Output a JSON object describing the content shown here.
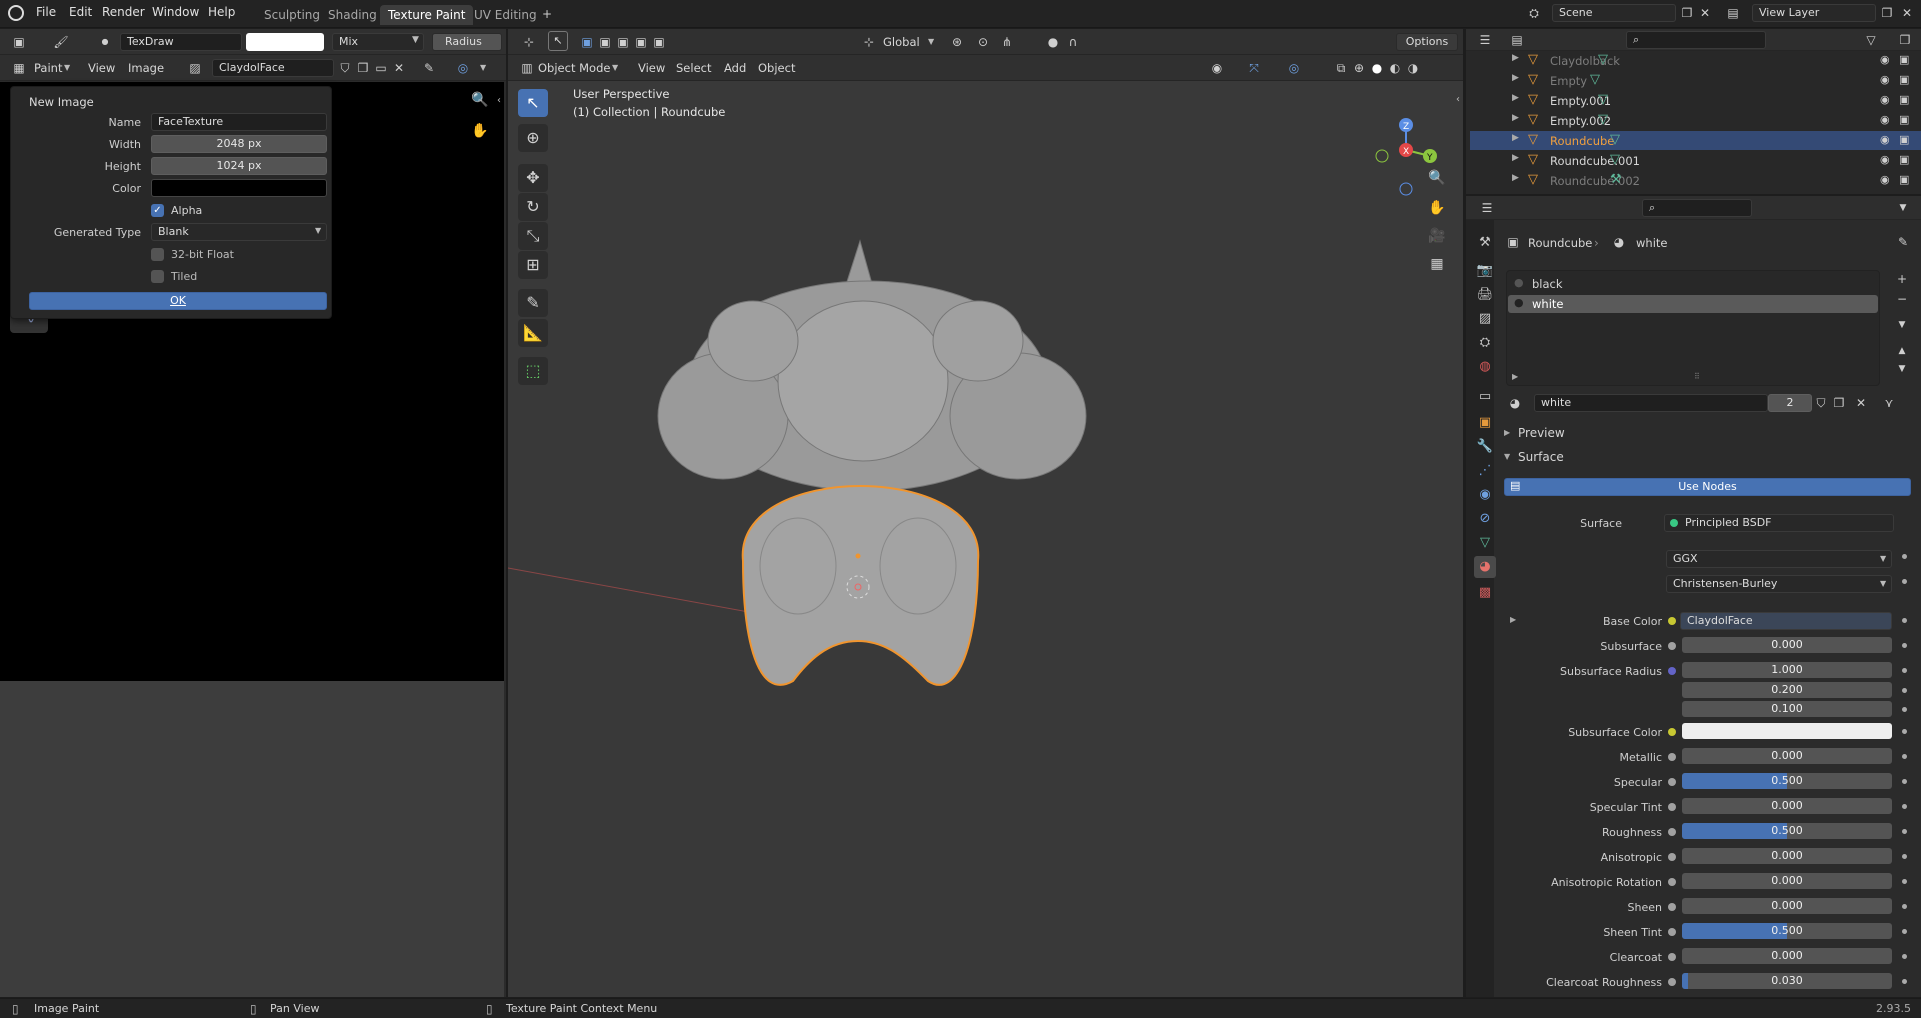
{
  "topbar": {
    "menus": [
      "File",
      "Edit",
      "Render",
      "Window",
      "Help"
    ],
    "workspaces": [
      "Sculpting",
      "Shading",
      "Texture Paint",
      "UV Editing"
    ],
    "active_workspace": "Texture Paint",
    "scene": "Scene",
    "view_layer": "View Layer"
  },
  "image_editor": {
    "brush_name": "TexDraw",
    "blend_mode": "Mix",
    "radius_label": "Radius",
    "mode_label": "Paint",
    "menus": [
      "View",
      "Image"
    ],
    "image_name": "ClaydolFace"
  },
  "new_image_dialog": {
    "title": "New Image",
    "name_label": "Name",
    "name_value": "FaceTexture",
    "width_label": "Width",
    "width_value": "2048 px",
    "height_label": "Height",
    "height_value": "1024 px",
    "color_label": "Color",
    "color_value": "#000000",
    "alpha_label": "Alpha",
    "alpha_checked": true,
    "generated_type_label": "Generated Type",
    "generated_type_value": "Blank",
    "float_label": "32-bit Float",
    "float_checked": false,
    "tiled_label": "Tiled",
    "tiled_checked": false,
    "ok_label": "OK"
  },
  "viewport": {
    "mode": "Object Mode",
    "menus": [
      "View",
      "Select",
      "Add",
      "Object"
    ],
    "orientation": "Global",
    "options_label": "Options",
    "perspective_label": "User Perspective",
    "collection_label": "(1) Collection | Roundcube"
  },
  "outliner": {
    "rows": [
      {
        "name": "Claydolback",
        "selected": false,
        "dim": true
      },
      {
        "name": "Empty",
        "selected": false,
        "dim": true
      },
      {
        "name": "Empty.001",
        "selected": false,
        "dim": false
      },
      {
        "name": "Empty.002",
        "selected": false,
        "dim": false
      },
      {
        "name": "Roundcube",
        "selected": true,
        "dim": false
      },
      {
        "name": "Roundcube.001",
        "selected": false,
        "dim": false
      },
      {
        "name": "Roundcube.002",
        "selected": false,
        "dim": true
      }
    ]
  },
  "properties": {
    "breadcrumb_object": "Roundcube",
    "breadcrumb_material": "white",
    "material_slots": [
      "black",
      "white"
    ],
    "selected_slot": "white",
    "material_name": "white",
    "material_users": "2",
    "preview_label": "Preview",
    "surface_panel_label": "Surface",
    "use_nodes_label": "Use Nodes",
    "surface_label": "Surface",
    "surface_value": "Principled BSDF",
    "distribution": "GGX",
    "subsurface_method": "Christensen-Burley",
    "params": [
      {
        "label": "Base Color",
        "value": "ClaydolFace",
        "kind": "link",
        "socket": "#c8c832"
      },
      {
        "label": "Subsurface",
        "value": "0.000",
        "fill": 0,
        "socket": "#a1a1a1"
      },
      {
        "label": "Subsurface Radius",
        "value": "1.000",
        "fill": 0,
        "socket": "#6363c7"
      },
      {
        "label": "",
        "value": "0.200",
        "fill": 0,
        "socket": ""
      },
      {
        "label": "",
        "value": "0.100",
        "fill": 0,
        "socket": ""
      },
      {
        "label": "Subsurface Color",
        "value": "",
        "kind": "color",
        "socket": "#c8c832"
      },
      {
        "label": "Metallic",
        "value": "0.000",
        "fill": 0,
        "socket": "#a1a1a1"
      },
      {
        "label": "Specular",
        "value": "0.500",
        "fill": 0.5,
        "socket": "#a1a1a1"
      },
      {
        "label": "Specular Tint",
        "value": "0.000",
        "fill": 0,
        "socket": "#a1a1a1"
      },
      {
        "label": "Roughness",
        "value": "0.500",
        "fill": 0.5,
        "socket": "#a1a1a1"
      },
      {
        "label": "Anisotropic",
        "value": "0.000",
        "fill": 0,
        "socket": "#a1a1a1"
      },
      {
        "label": "Anisotropic Rotation",
        "value": "0.000",
        "fill": 0,
        "socket": "#a1a1a1"
      },
      {
        "label": "Sheen",
        "value": "0.000",
        "fill": 0,
        "socket": "#a1a1a1"
      },
      {
        "label": "Sheen Tint",
        "value": "0.500",
        "fill": 0.5,
        "socket": "#a1a1a1"
      },
      {
        "label": "Clearcoat",
        "value": "0.000",
        "fill": 0,
        "socket": "#a1a1a1"
      },
      {
        "label": "Clearcoat Roughness",
        "value": "0.030",
        "fill": 0.03,
        "socket": "#a1a1a1"
      }
    ]
  },
  "statusbar": {
    "left_action": "Image Paint",
    "middle_action": "Pan View",
    "right_action": "Texture Paint Context Menu",
    "version": "2.93.5"
  },
  "colors": {
    "accent": "#4772b3",
    "selection_outline": "#f0952f",
    "active_outliner": "#344a75"
  }
}
